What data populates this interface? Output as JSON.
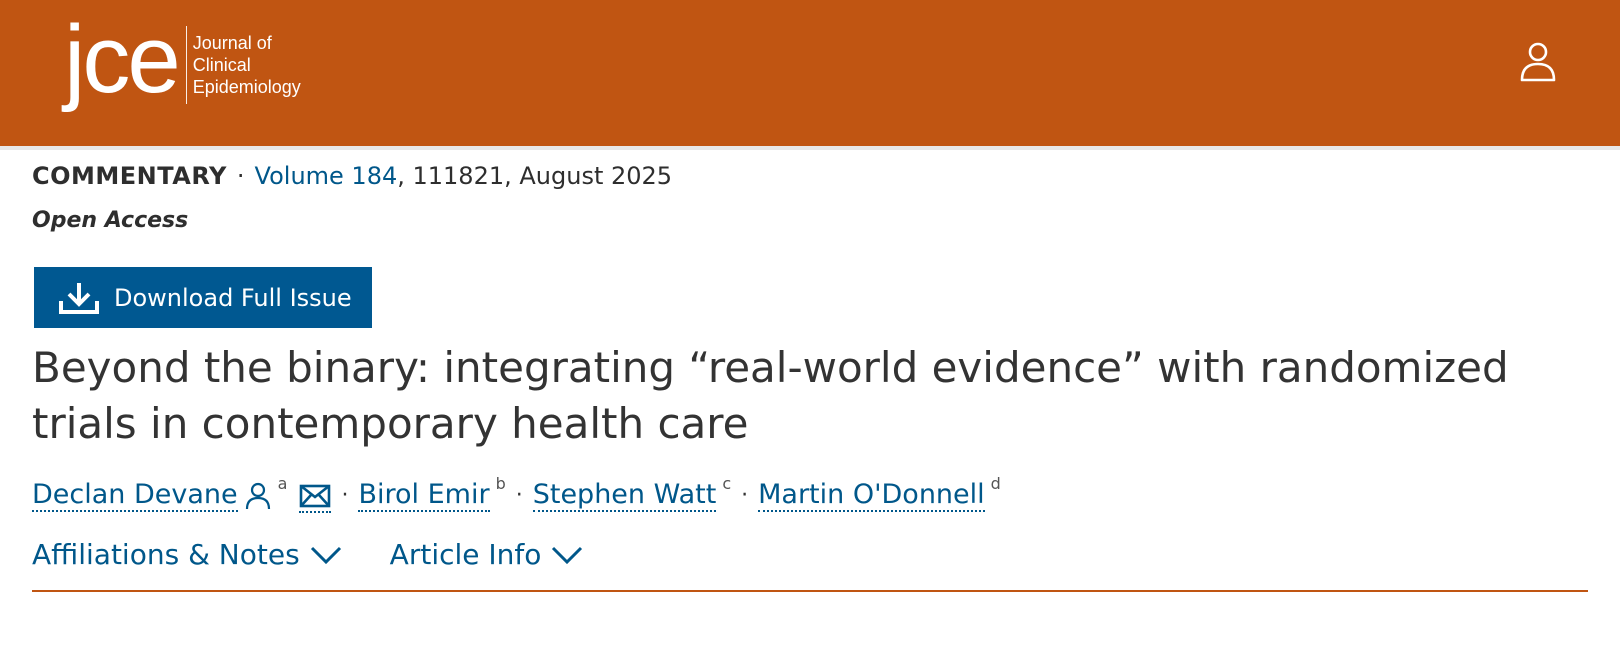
{
  "header": {
    "logo_mark": "jce",
    "logo_text": [
      "Journal of",
      "Clinical",
      "Epidemiology"
    ],
    "user_icon": "user-icon",
    "color": "#c05512"
  },
  "meta": {
    "article_type": "COMMENTARY",
    "separator": "·",
    "volume_link": "Volume 184",
    "citation": ", 111821, August 2025",
    "access": "Open Access"
  },
  "download": {
    "label": "Download Full Issue",
    "icon": "download-icon",
    "color": "#005891"
  },
  "article": {
    "title": "Beyond the binary: integrating “real-world evidence” with randomized trials in contemporary health care"
  },
  "authors": [
    {
      "name": "Declan Devane",
      "sup": "a"
    },
    {
      "name": "Birol Emir",
      "sup": "b"
    },
    {
      "name": "Stephen Watt",
      "sup": "c"
    },
    {
      "name": "Martin O'Donnell",
      "sup": "d"
    }
  ],
  "author_separator": "·",
  "tabs": [
    {
      "label": "Affiliations & Notes",
      "icon": "chevron-down-icon"
    },
    {
      "label": "Article Info",
      "icon": "chevron-down-icon"
    }
  ],
  "colors": {
    "link": "#00578a",
    "accent": "#c05512"
  }
}
